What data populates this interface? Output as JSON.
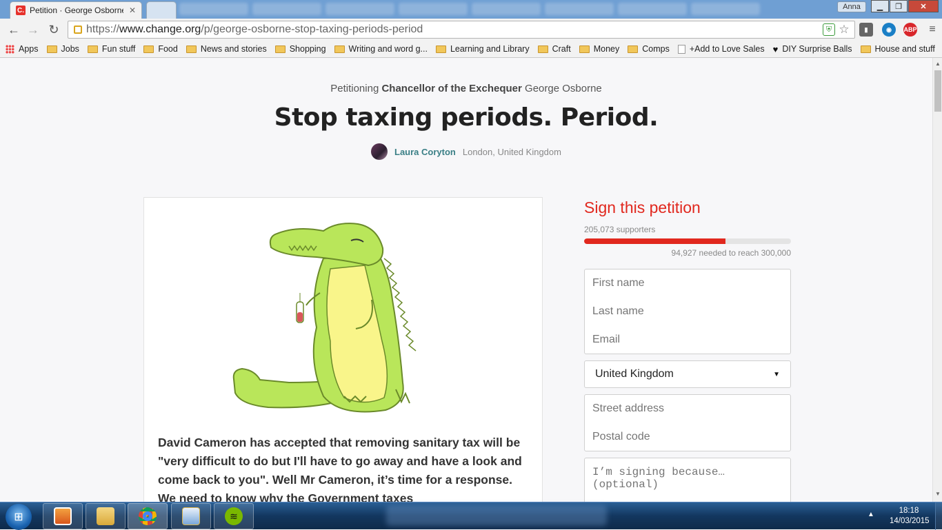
{
  "browser": {
    "tab_title": "Petition · George Osborne",
    "tab_favicon": "C.",
    "profile_name": "Anna",
    "url_scheme": "https://",
    "url_host": "www.change.org",
    "url_path": "/p/george-osborne-stop-taxing-periods-period"
  },
  "bookmarks": [
    {
      "label": "Apps",
      "icon": "apps-grid-icon"
    },
    {
      "label": "Jobs",
      "icon": "folder-icon"
    },
    {
      "label": "Fun stuff",
      "icon": "folder-icon"
    },
    {
      "label": "Food",
      "icon": "folder-icon"
    },
    {
      "label": "News and stories",
      "icon": "folder-icon"
    },
    {
      "label": "Shopping",
      "icon": "folder-icon"
    },
    {
      "label": "Writing and word g...",
      "icon": "folder-icon"
    },
    {
      "label": "Learning and Library",
      "icon": "folder-icon"
    },
    {
      "label": "Craft",
      "icon": "folder-icon"
    },
    {
      "label": "Money",
      "icon": "folder-icon"
    },
    {
      "label": "Comps",
      "icon": "folder-icon"
    },
    {
      "label": "+Add to Love Sales",
      "icon": "page-icon"
    },
    {
      "label": "DIY Surprise Balls",
      "icon": "heart-icon"
    },
    {
      "label": "House and stuff",
      "icon": "folder-icon"
    }
  ],
  "petition": {
    "petitioning_prefix": "Petitioning",
    "target_title": "Chancellor of the Exchequer",
    "target_name": "George Osborne",
    "headline": "Stop taxing periods. Period.",
    "author_name": "Laura Coryton",
    "author_location": "London, United Kingdom",
    "description": "David Cameron has accepted that removing sanitary tax will be \"very difficult to do but I'll have to go away and have a look and come back to you\". Well Mr Cameron, it’s time for a response. We need to know why the Government taxes"
  },
  "sign": {
    "title": "Sign this petition",
    "supporters_label": "205,073 supporters",
    "needed_label": "94,927 needed to reach 300,000",
    "progress_fraction": 0.6836,
    "placeholders": {
      "first_name": "First name",
      "last_name": "Last name",
      "email": "Email",
      "street": "Street address",
      "postal": "Postal code",
      "reason": "I’m signing because… (optional)"
    },
    "country": "United Kingdom"
  },
  "taskbar": {
    "time": "18:18",
    "date": "14/03/2015"
  },
  "colors": {
    "accent_red": "#e1281e",
    "author_teal": "#3a7f86",
    "croc_green": "#b9e65a",
    "croc_belly": "#f9f58a"
  }
}
